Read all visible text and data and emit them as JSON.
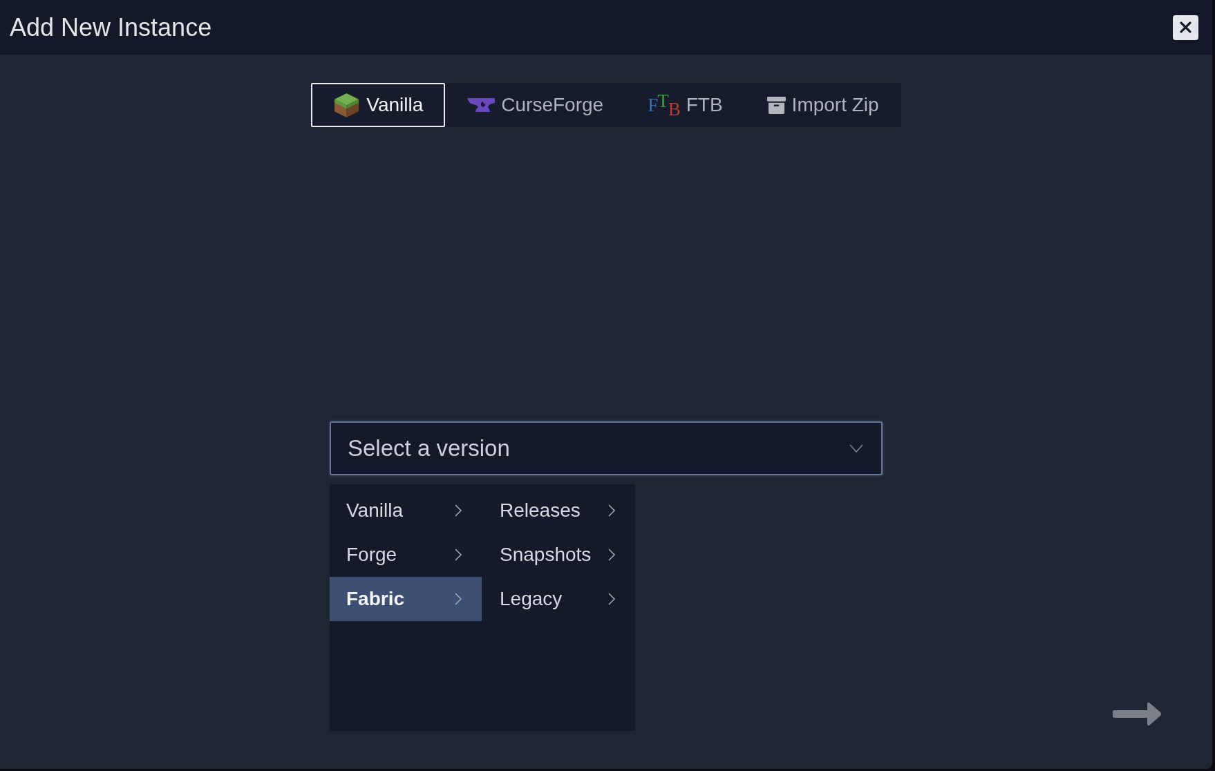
{
  "window": {
    "title": "Add New Instance"
  },
  "tabs": [
    {
      "label": "Vanilla",
      "selected": true
    },
    {
      "label": "CurseForge",
      "selected": false
    },
    {
      "label": "FTB",
      "selected": false,
      "logo": [
        {
          "text": "F",
          "color": "#3a6db5"
        },
        {
          "text": "T",
          "color": "#3f9a40"
        },
        {
          "text": "B",
          "color": "#c23b2e"
        }
      ]
    },
    {
      "label": "Import Zip",
      "selected": false
    }
  ],
  "version_select": {
    "placeholder": "Select a version",
    "expanded": true
  },
  "version_menu": {
    "columns": [
      {
        "items": [
          {
            "label": "Vanilla",
            "selected": false
          },
          {
            "label": "Forge",
            "selected": false
          },
          {
            "label": "Fabric",
            "selected": true
          }
        ]
      },
      {
        "items": [
          {
            "label": "Releases",
            "selected": false
          },
          {
            "label": "Snapshots",
            "selected": false
          },
          {
            "label": "Legacy",
            "selected": false
          }
        ]
      }
    ]
  }
}
